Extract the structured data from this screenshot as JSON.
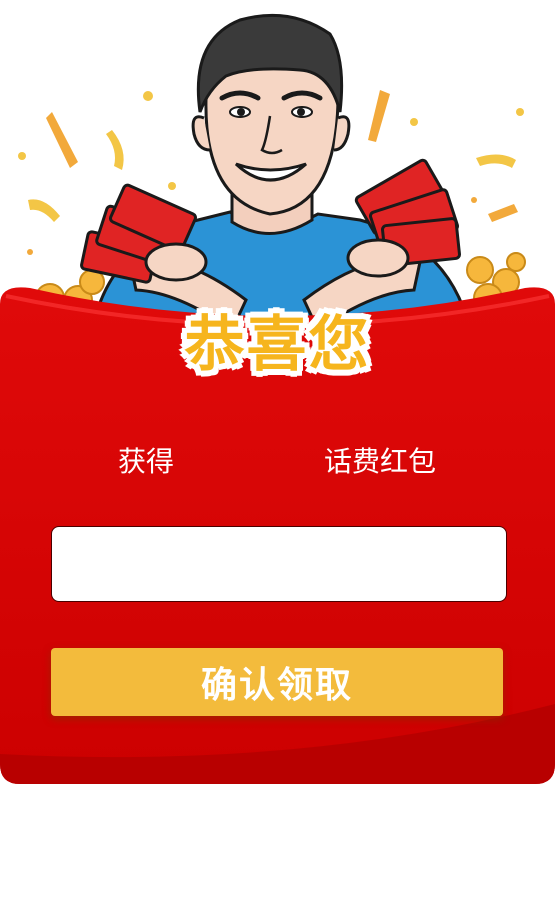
{
  "banner": {
    "title": "恭喜您",
    "illustration": "man-holding-red-envelopes"
  },
  "prize": {
    "label": "获得",
    "name": "话费红包"
  },
  "form": {
    "phone_value": "",
    "phone_placeholder": ""
  },
  "actions": {
    "confirm_label": "确认领取"
  },
  "colors": {
    "envelope_red": "#d40000",
    "envelope_dark": "#b80000",
    "button_gold": "#f3bb3c",
    "title_gold": "#f6b51d",
    "shirt_blue": "#2b93d6"
  }
}
